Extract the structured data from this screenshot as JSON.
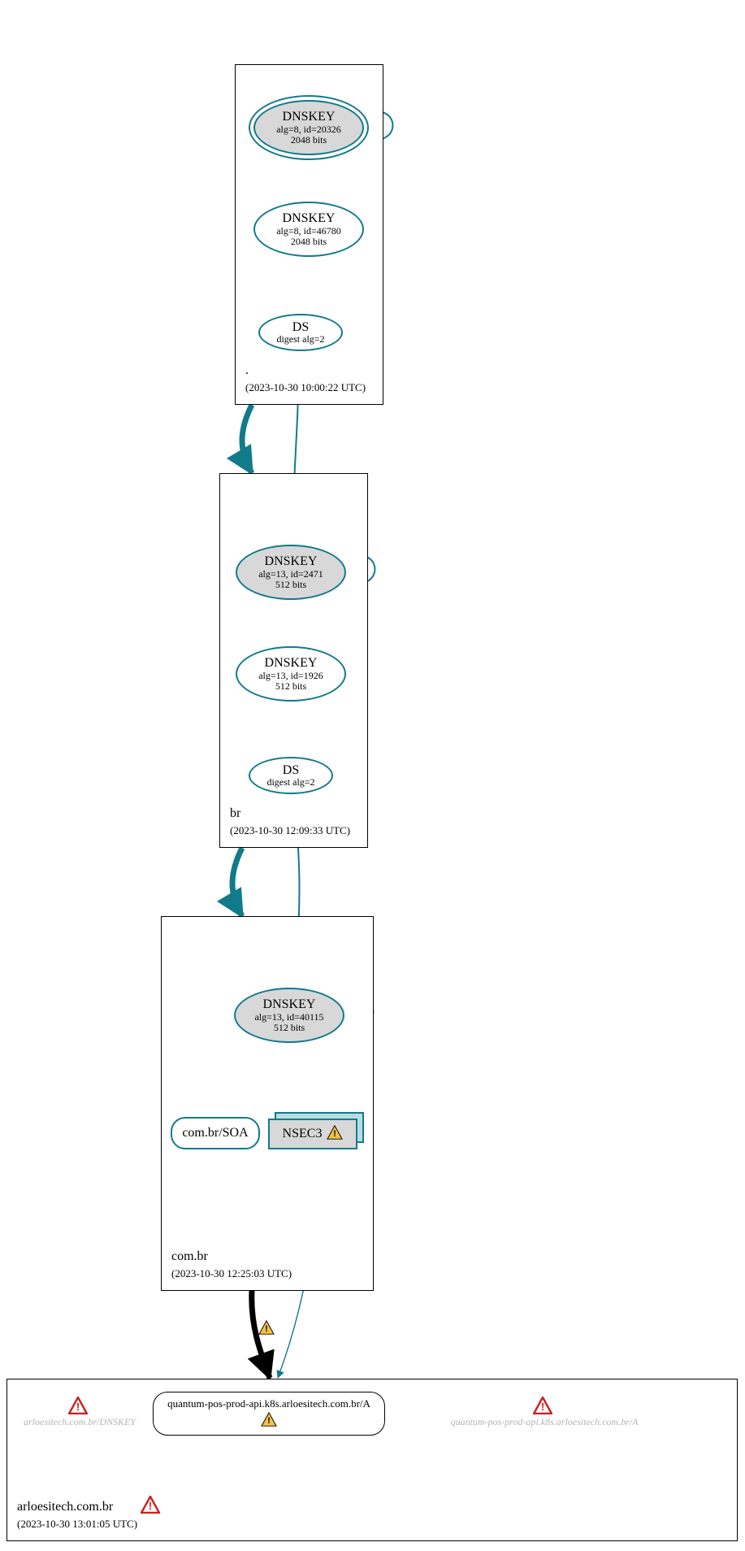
{
  "zones": {
    "root": {
      "label": ".",
      "timestamp": "(2023-10-30 10:00:22 UTC)"
    },
    "br": {
      "label": "br",
      "timestamp": "(2023-10-30 12:09:33 UTC)"
    },
    "combr": {
      "label": "com.br",
      "timestamp": "(2023-10-30 12:25:03 UTC)"
    },
    "arlo": {
      "label": "arloesitech.com.br",
      "timestamp": "(2023-10-30 13:01:05 UTC)"
    }
  },
  "nodes": {
    "root_ksk": {
      "title": "DNSKEY",
      "sub1": "alg=8, id=20326",
      "sub2": "2048 bits"
    },
    "root_zsk": {
      "title": "DNSKEY",
      "sub1": "alg=8, id=46780",
      "sub2": "2048 bits"
    },
    "root_ds": {
      "title": "DS",
      "sub1": "digest alg=2",
      "sub2": ""
    },
    "br_ksk": {
      "title": "DNSKEY",
      "sub1": "alg=13, id=2471",
      "sub2": "512 bits"
    },
    "br_zsk": {
      "title": "DNSKEY",
      "sub1": "alg=13, id=1926",
      "sub2": "512 bits"
    },
    "br_ds": {
      "title": "DS",
      "sub1": "digest alg=2",
      "sub2": ""
    },
    "combr_ksk": {
      "title": "DNSKEY",
      "sub1": "alg=13, id=40115",
      "sub2": "512 bits"
    },
    "combr_soa": {
      "label": "com.br/SOA"
    },
    "nsec3": {
      "label": "NSEC3"
    },
    "ghost_dnskey": {
      "label": "arloesitech.com.br/DNSKEY"
    },
    "query": {
      "label": "quantum-pos-prod-api.k8s.arloesitech.com.br/A"
    },
    "ghost_a": {
      "label": "quantum-pos-prod-api.k8s.arloesitech.com.br/A"
    }
  },
  "colors": {
    "teal": "#117a8b",
    "yellow": "#f6c244",
    "red": "#cc1f1f"
  }
}
